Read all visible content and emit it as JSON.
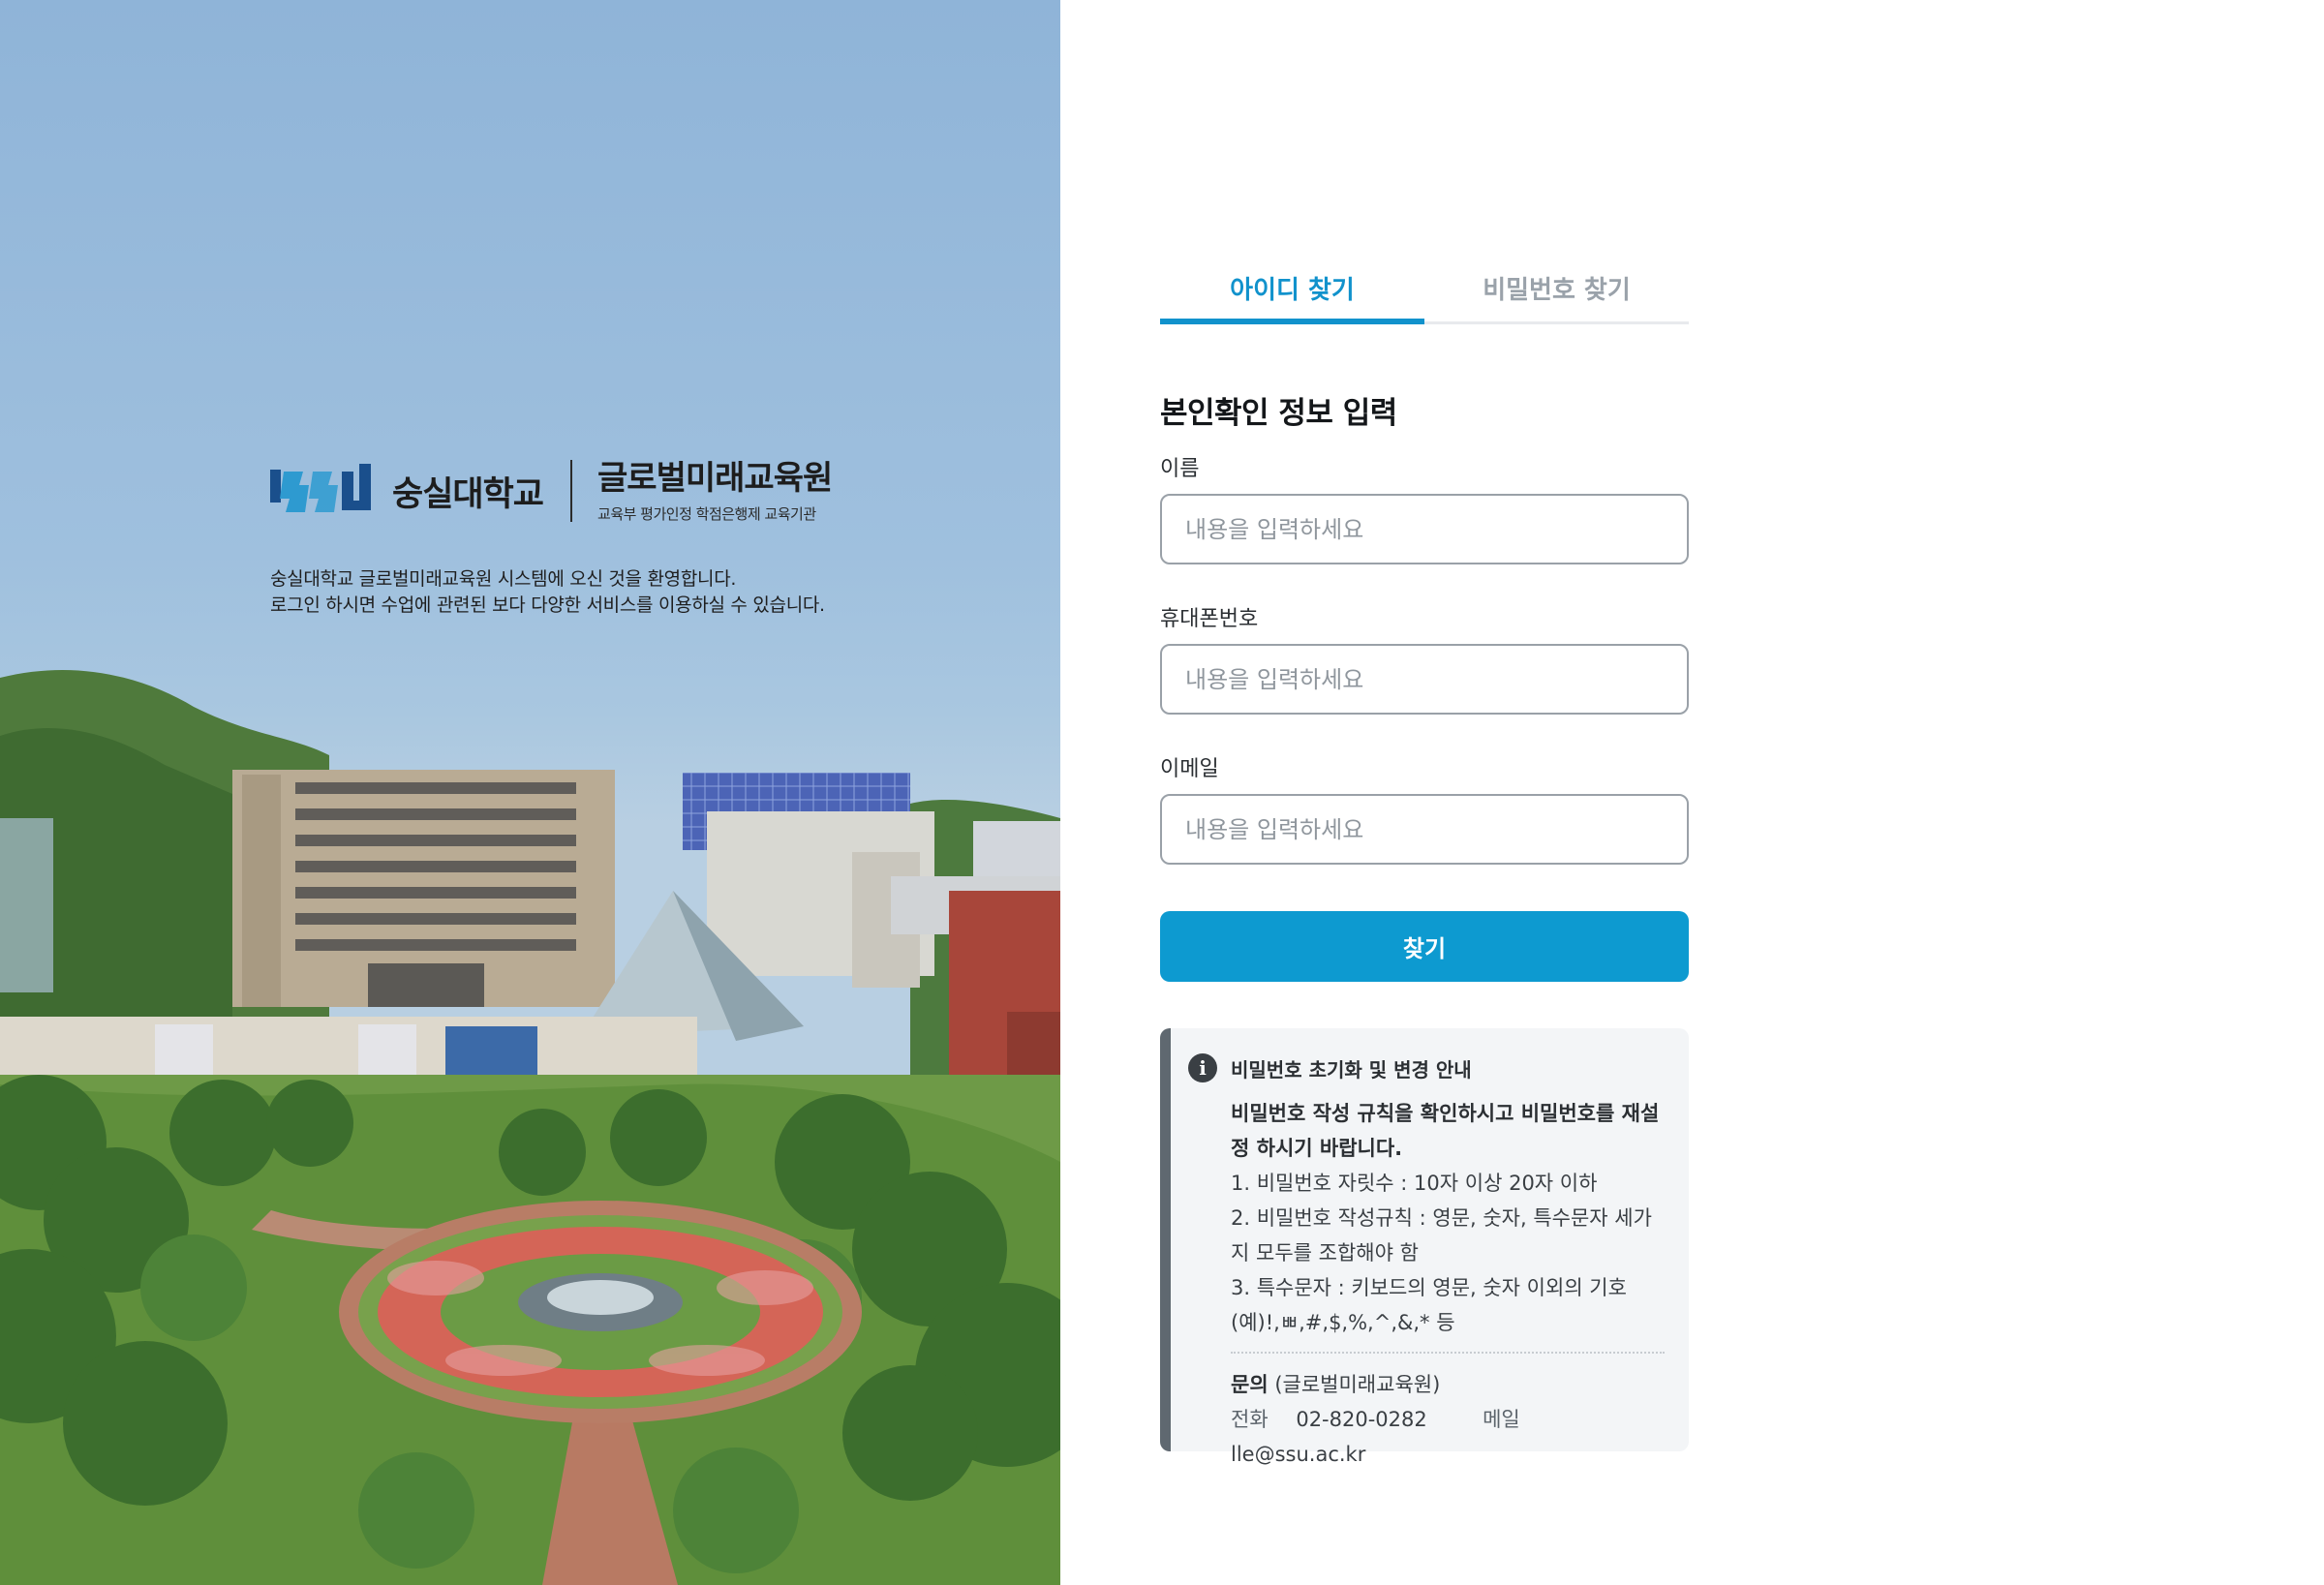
{
  "hero": {
    "university_name": "숭실대학교",
    "institute_name": "글로벌미래교육원",
    "institute_subtitle": "교육부 평가인정 학점은행제 교육기관",
    "welcome_line1": "숭실대학교 글로벌미래교육원 시스템에 오신 것을 환영합니다.",
    "welcome_line2": "로그인 하시면 수업에 관련된 보다 다양한 서비스를 이용하실 수 있습니다."
  },
  "tabs": [
    {
      "label": "아이디 찾기",
      "active": true
    },
    {
      "label": "비밀번호 찾기",
      "active": false
    }
  ],
  "form": {
    "section_title": "본인확인 정보 입력",
    "fields": [
      {
        "label": "이름",
        "placeholder": "내용을 입력하세요",
        "value": ""
      },
      {
        "label": "휴대폰번호",
        "placeholder": "내용을 입력하세요",
        "value": ""
      },
      {
        "label": "이메일",
        "placeholder": "내용을 입력하세요",
        "value": ""
      }
    ],
    "submit_label": "찾기"
  },
  "notice": {
    "icon": "info-icon",
    "title": "비밀번호 초기화 및 변경 안내",
    "intro_line1": "비밀번호 작성 규칙을 확인하시고 비밀번호를 재설",
    "intro_line2": "정 하시기 바랍니다.",
    "rule1": "1. 비밀번호 자릿수 : 10자 이상 20자 이하",
    "rule2_line1": "2. 비밀번호 작성규칙 : 영문, 숫자, 특수문자 세가",
    "rule2_line2": "지 모두를 조합해야 함",
    "rule3_line1": "3. 특수문자 : 키보드의 영문, 숫자 이외의 기호",
    "rule3_line2": "(예)!,ㅃ,#,$,%,^,&,* 등",
    "contact_heading": "문의",
    "contact_org": "(글로벌미래교육원)",
    "phone_label": "전화",
    "phone": "02-820-0282",
    "email_label": "메일",
    "email": "lle@ssu.ac.kr"
  },
  "colors": {
    "accent": "#1192cc",
    "button": "#0d9ad0",
    "notice_bg": "#f3f5f7",
    "notice_bar": "#5f6870"
  }
}
